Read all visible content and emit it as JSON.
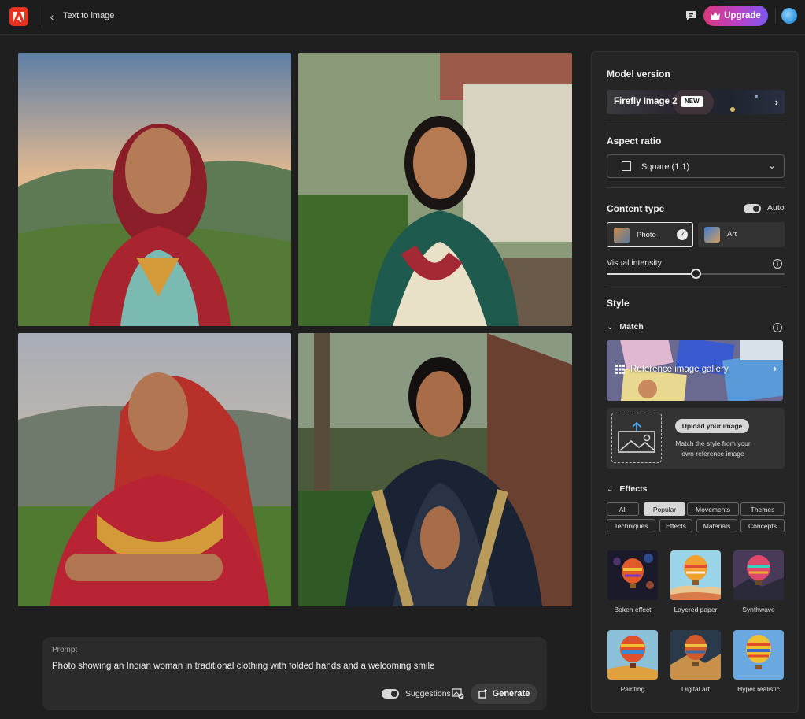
{
  "header": {
    "title": "Text to image",
    "upgrade_label": "Upgrade"
  },
  "prompt": {
    "label": "Prompt",
    "text": "Photo showing an Indian woman in traditional clothing with folded hands and a welcoming smile",
    "suggestions_label": "Suggestions",
    "generate_label": "Generate"
  },
  "panel": {
    "model": {
      "title": "Model version",
      "name": "Firefly Image 2",
      "badge": "NEW"
    },
    "aspect": {
      "title": "Aspect ratio",
      "value": "Square (1:1)"
    },
    "content_type": {
      "title": "Content type",
      "auto_label": "Auto",
      "options": [
        {
          "label": "Photo",
          "selected": true
        },
        {
          "label": "Art",
          "selected": false
        }
      ],
      "visual_intensity_label": "Visual intensity",
      "visual_intensity_value": 0.5
    },
    "style": {
      "title": "Style",
      "match_label": "Match",
      "gallery_label": "Reference image gallery",
      "upload_label": "Upload your image",
      "upload_desc": "Match the style from your own reference image"
    },
    "effects": {
      "title": "Effects",
      "chips": [
        "All",
        "Popular",
        "Movements",
        "Themes",
        "Techniques",
        "Effects",
        "Materials",
        "Concepts"
      ],
      "active_chip": "Popular",
      "items": [
        "Bokeh effect",
        "Layered paper",
        "Synthwave",
        "Painting",
        "Digital art",
        "Hyper realistic"
      ]
    }
  },
  "colors": {
    "accent_red": "#e8321f",
    "upgrade_start": "#d9377a",
    "upgrade_end": "#7c58f0",
    "panel_bg": "#252525"
  }
}
